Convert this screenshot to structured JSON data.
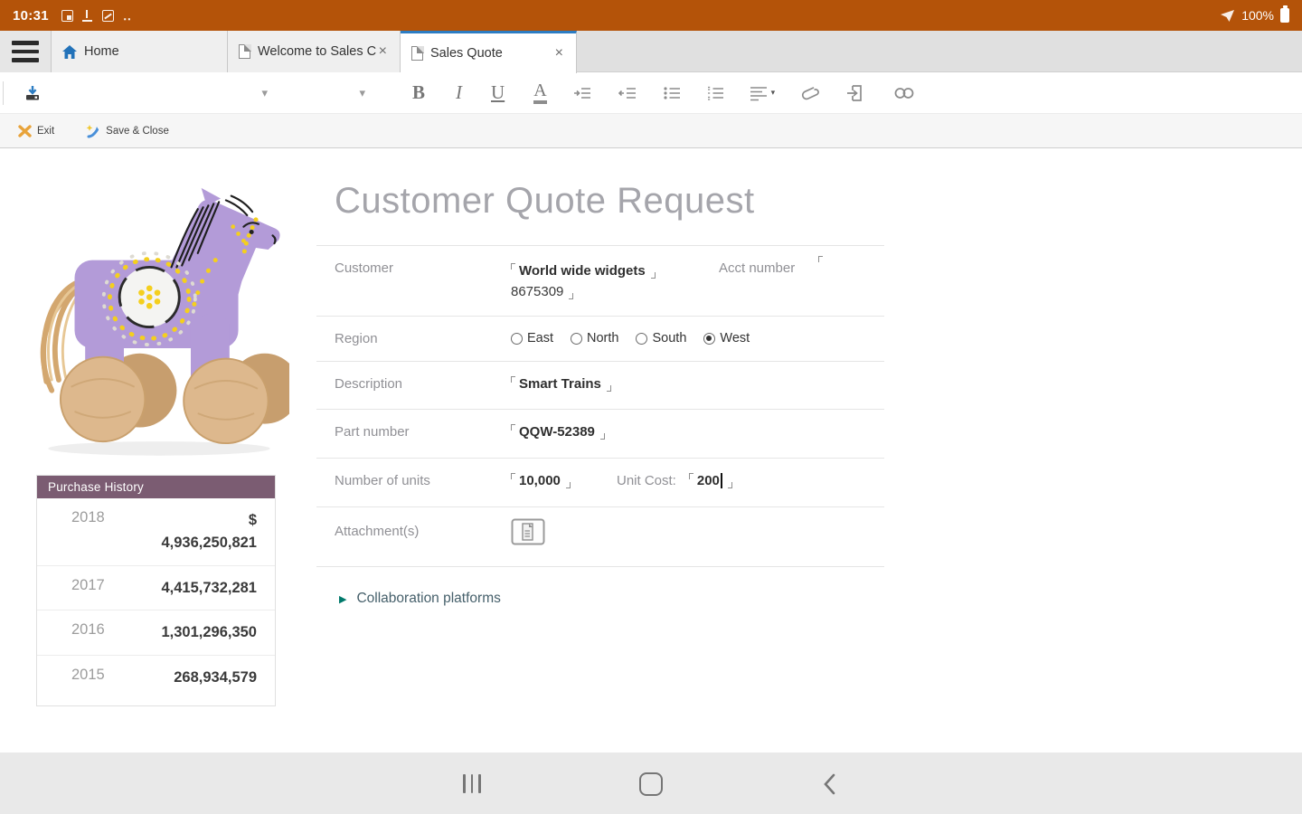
{
  "status_bar": {
    "time": "10:31",
    "battery_percent": "100%"
  },
  "icons": {
    "caret_down": "▾",
    "close": "×",
    "collapsed_arrow": "▶",
    "more_dots": "‥"
  },
  "tab_bar": {
    "tabs": [
      {
        "label": "Home"
      },
      {
        "label": "Welcome to Sales C..."
      },
      {
        "label": "Sales Quote"
      }
    ]
  },
  "toolbar": {
    "bold": "B",
    "italic": "I",
    "underline": "U",
    "text_color": "A"
  },
  "action_bar": {
    "exit": "Exit",
    "save_close": "Save & Close"
  },
  "form": {
    "title": "Customer Quote Request",
    "customer": {
      "label": "Customer",
      "value": "World wide widgets"
    },
    "acct": {
      "label": "Acct number",
      "value": "8675309"
    },
    "region": {
      "label": "Region",
      "options": [
        {
          "label": "East",
          "selected": false
        },
        {
          "label": "North",
          "selected": false
        },
        {
          "label": "South",
          "selected": false
        },
        {
          "label": "West",
          "selected": true
        }
      ]
    },
    "description": {
      "label": "Description",
      "value": "Smart Trains"
    },
    "part": {
      "label": "Part number",
      "value": "QQW-52389"
    },
    "units": {
      "label": "Number of units",
      "value": "10,000"
    },
    "unit_cost": {
      "label": "Unit Cost:",
      "value": "200"
    },
    "attachments": {
      "label": "Attachment(s)"
    },
    "collaboration": {
      "label": "Collaboration platforms"
    }
  },
  "purchase_history": {
    "title": "Purchase History",
    "rows": [
      {
        "year": "2018",
        "currency": "$",
        "amount": "4,936,250,821"
      },
      {
        "year": "2017",
        "currency": "",
        "amount": "4,415,732,281"
      },
      {
        "year": "2016",
        "currency": "",
        "amount": "1,301,296,350"
      },
      {
        "year": "2015",
        "currency": "",
        "amount": "268,934,579"
      }
    ]
  },
  "colors": {
    "status_bar": "#b45309",
    "active_tab_accent": "#2d7dc3",
    "purchase_header": "#7b5c72",
    "collaboration_accent": "#00796b"
  }
}
